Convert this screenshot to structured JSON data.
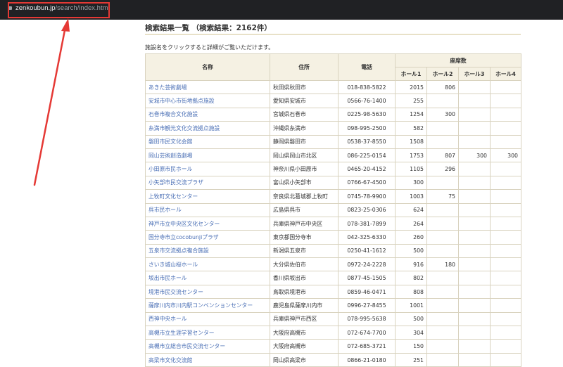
{
  "browser": {
    "url_host": "zenkoubun.jp",
    "url_path": "/search/index.html"
  },
  "accent": {
    "highlight_red": "#e53935",
    "link_blue": "#4a6fb5",
    "header_bg": "#f5f1e3"
  },
  "page": {
    "heading": "検索結果一覧 （検索結果：2162件）",
    "intro": "施設名をクリックすると詳細がご覧いただけます。"
  },
  "table": {
    "headers": {
      "name": "名称",
      "address": "住所",
      "tel": "電話",
      "seats": "座席数",
      "halls": [
        "ホール1",
        "ホール2",
        "ホール3",
        "ホール4"
      ]
    },
    "rows": [
      {
        "name": "あきた芸術劇場",
        "address": "秋田県秋田市",
        "tel": "018-838-5822",
        "h1": "2015",
        "h2": "806",
        "h3": "",
        "h4": ""
      },
      {
        "name": "安城市中心市街地拠点施設",
        "address": "愛知県安城市",
        "tel": "0566-76-1400",
        "h1": "255",
        "h2": "",
        "h3": "",
        "h4": ""
      },
      {
        "name": "石巻市複合文化施設",
        "address": "宮城県石巻市",
        "tel": "0225-98-5630",
        "h1": "1254",
        "h2": "300",
        "h3": "",
        "h4": ""
      },
      {
        "name": "糸満市観光文化交流拠点施設",
        "address": "沖縄県糸満市",
        "tel": "098-995-2500",
        "h1": "582",
        "h2": "",
        "h3": "",
        "h4": ""
      },
      {
        "name": "磐田市民文化会館",
        "address": "静岡県磐田市",
        "tel": "0538-37-8550",
        "h1": "1508",
        "h2": "",
        "h3": "",
        "h4": ""
      },
      {
        "name": "岡山芸術創造劇場",
        "address": "岡山県岡山市北区",
        "tel": "086-225-0154",
        "h1": "1753",
        "h2": "807",
        "h3": "300",
        "h4": "300"
      },
      {
        "name": "小田原市民ホール",
        "address": "神奈川県小田原市",
        "tel": "0465-20-4152",
        "h1": "1105",
        "h2": "296",
        "h3": "",
        "h4": ""
      },
      {
        "name": "小矢部市民交流プラザ",
        "address": "富山県小矢部市",
        "tel": "0766-67-4500",
        "h1": "300",
        "h2": "",
        "h3": "",
        "h4": ""
      },
      {
        "name": "上牧町文化センター",
        "address": "奈良県北葛城郡上牧町",
        "tel": "0745-78-9900",
        "h1": "1003",
        "h2": "75",
        "h3": "",
        "h4": ""
      },
      {
        "name": "呉市民ホール",
        "address": "広島県呉市",
        "tel": "0823-25-0306",
        "h1": "624",
        "h2": "",
        "h3": "",
        "h4": ""
      },
      {
        "name": "神戸市立中央区文化センター",
        "address": "兵庫県神戸市中央区",
        "tel": "078-381-7899",
        "h1": "264",
        "h2": "",
        "h3": "",
        "h4": ""
      },
      {
        "name": "国分寺市立cocobunjiプラザ",
        "address": "東京都国分寺市",
        "tel": "042-325-6330",
        "h1": "260",
        "h2": "",
        "h3": "",
        "h4": ""
      },
      {
        "name": "五泉市交流拠点複合施設",
        "address": "新潟県五泉市",
        "tel": "0250-41-1612",
        "h1": "500",
        "h2": "",
        "h3": "",
        "h4": ""
      },
      {
        "name": "さいき城山桜ホール",
        "address": "大分県佐伯市",
        "tel": "0972-24-2228",
        "h1": "916",
        "h2": "180",
        "h3": "",
        "h4": ""
      },
      {
        "name": "坂出市民ホール",
        "address": "香川県坂出市",
        "tel": "0877-45-1505",
        "h1": "802",
        "h2": "",
        "h3": "",
        "h4": ""
      },
      {
        "name": "境港市民交流センター",
        "address": "鳥取県境港市",
        "tel": "0859-46-0471",
        "h1": "808",
        "h2": "",
        "h3": "",
        "h4": ""
      },
      {
        "name": "薩摩川内市川内駅コンベンションセンター",
        "address": "鹿児島県薩摩川内市",
        "tel": "0996-27-8455",
        "h1": "1001",
        "h2": "",
        "h3": "",
        "h4": ""
      },
      {
        "name": "西神中央ホール",
        "address": "兵庫県神戸市西区",
        "tel": "078-995-5638",
        "h1": "500",
        "h2": "",
        "h3": "",
        "h4": ""
      },
      {
        "name": "高槻市立生涯学習センター",
        "address": "大阪府高槻市",
        "tel": "072-674-7700",
        "h1": "304",
        "h2": "",
        "h3": "",
        "h4": ""
      },
      {
        "name": "高槻市立総合市民交流センター",
        "address": "大阪府高槻市",
        "tel": "072-685-3721",
        "h1": "150",
        "h2": "",
        "h3": "",
        "h4": ""
      },
      {
        "name": "高梁市文化交流館",
        "address": "岡山県高梁市",
        "tel": "0866-21-0180",
        "h1": "251",
        "h2": "",
        "h3": "",
        "h4": ""
      }
    ]
  }
}
